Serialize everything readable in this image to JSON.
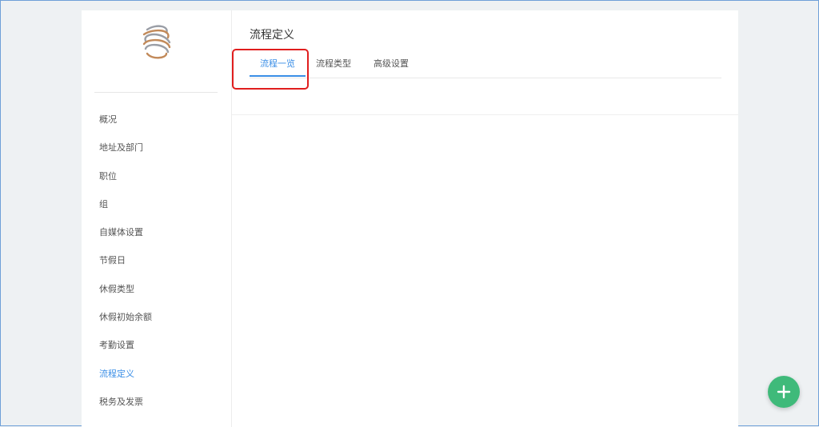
{
  "sidebar": {
    "logo": "swirl-logo",
    "items": [
      {
        "label": "概况"
      },
      {
        "label": "地址及部门"
      },
      {
        "label": "职位"
      },
      {
        "label": "组"
      },
      {
        "label": "自媒体设置"
      },
      {
        "label": "节假日"
      },
      {
        "label": "休假类型"
      },
      {
        "label": "休假初始余额"
      },
      {
        "label": "考勤设置"
      },
      {
        "label": "流程定义"
      },
      {
        "label": "税务及发票"
      }
    ],
    "active_index": 9
  },
  "main": {
    "title": "流程定义",
    "tabs": [
      {
        "label": "流程一览"
      },
      {
        "label": "流程类型"
      },
      {
        "label": "高级设置"
      }
    ],
    "active_tab": 0
  },
  "fab": {
    "icon": "plus-icon"
  },
  "colors": {
    "accent": "#3a8ee6",
    "fab": "#3fba7a",
    "highlight": "#e01e1e",
    "background": "#eef1f3"
  }
}
